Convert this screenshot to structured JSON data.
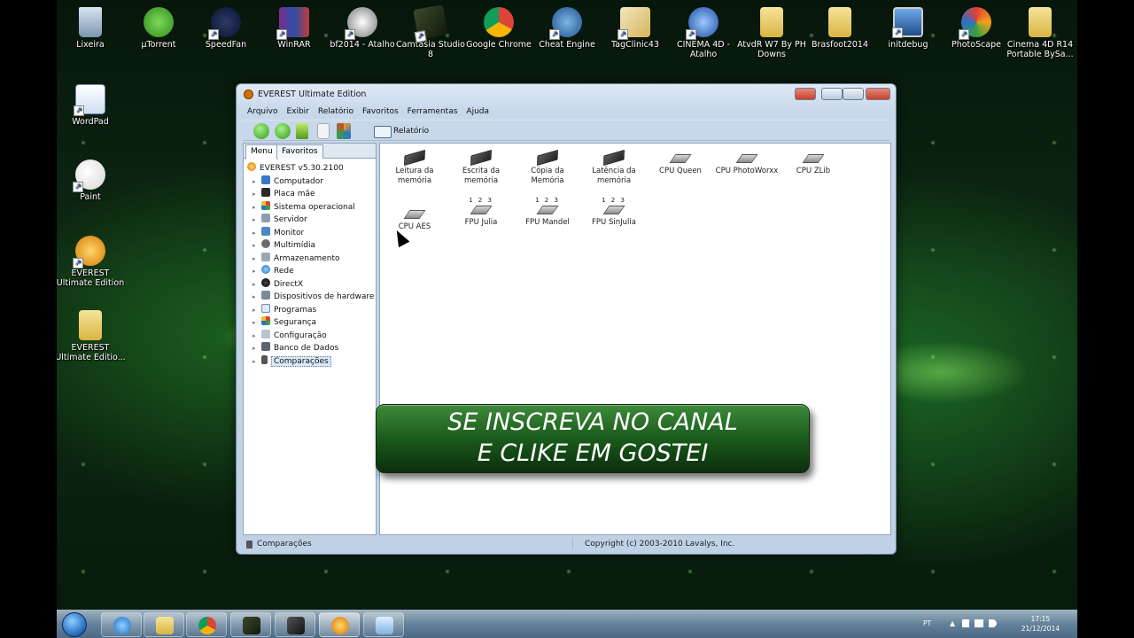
{
  "desktop": {
    "icons": [
      {
        "label": "Lixeira",
        "icon": "recycle-bin-icon"
      },
      {
        "label": "µTorrent",
        "icon": "utorrent-icon"
      },
      {
        "label": "SpeedFan",
        "icon": "speedfan-icon"
      },
      {
        "label": "WinRAR",
        "icon": "winrar-icon"
      },
      {
        "label": "bf2014 - Atalho",
        "icon": "game-icon"
      },
      {
        "label": "Camtasia Studio 8",
        "icon": "camtasia-icon"
      },
      {
        "label": "Google Chrome",
        "icon": "chrome-icon"
      },
      {
        "label": "Cheat Engine",
        "icon": "cheat-engine-icon"
      },
      {
        "label": "TagClinic43",
        "icon": "tagclinic-icon"
      },
      {
        "label": "CINEMA 4D - Atalho",
        "icon": "cinema4d-icon"
      },
      {
        "label": "AtvdR W7 By PH Downs",
        "icon": "folder-icon"
      },
      {
        "label": "Brasfoot2014",
        "icon": "folder-icon"
      },
      {
        "label": "initdebug",
        "icon": "monitor-icon"
      },
      {
        "label": "PhotoScape",
        "icon": "photoscape-icon"
      },
      {
        "label": "Cinema 4D R14 Portable BySa...",
        "icon": "folder-icon"
      },
      {
        "label": "WordPad",
        "icon": "wordpad-icon"
      },
      {
        "label": "Paint",
        "icon": "paint-icon"
      },
      {
        "label": "EVEREST Ultimate Edition",
        "icon": "everest-icon"
      },
      {
        "label": "EVEREST Ultimate Editio...",
        "icon": "folder-icon"
      }
    ]
  },
  "window": {
    "title": "EVEREST Ultimate Edition",
    "menu": [
      "Arquivo",
      "Exibir",
      "Relatório",
      "Favoritos",
      "Ferramentas",
      "Ajuda"
    ],
    "toolbar": {
      "report_label": "Relatório"
    },
    "tabs": [
      "Menu",
      "Favoritos"
    ],
    "tree_root": "EVEREST v5.30.2100",
    "tree_items": [
      "Computador",
      "Placa mãe",
      "Sistema operacional",
      "Servidor",
      "Monitor",
      "Multimídia",
      "Armazenamento",
      "Rede",
      "DirectX",
      "Dispositivos de hardware",
      "Programas",
      "Segurança",
      "Configuração",
      "Banco de Dados",
      "Comparações"
    ],
    "selected_item": "Comparações",
    "benchmarks_row1": [
      {
        "label": "Leitura da memória",
        "kind": "chip"
      },
      {
        "label": "Escrita da memória",
        "kind": "chip"
      },
      {
        "label": "Cópia da Memória",
        "kind": "chip"
      },
      {
        "label": "Latência da memória",
        "kind": "chip"
      },
      {
        "label": "CPU Queen",
        "kind": "cpu"
      },
      {
        "label": "CPU PhotoWorxx",
        "kind": "cpu"
      },
      {
        "label": "CPU ZLib",
        "kind": "cpu"
      }
    ],
    "benchmarks_row2": [
      {
        "label": "CPU AES",
        "kind": "cpu"
      },
      {
        "label": "FPU Julia",
        "kind": "fpu"
      },
      {
        "label": "FPU Mandel",
        "kind": "fpu"
      },
      {
        "label": "FPU SinJulia",
        "kind": "fpu"
      }
    ],
    "fpu_digits": "1 2 3",
    "status_left": "Comparações",
    "status_right": "Copyright (c) 2003-2010 Lavalys, Inc."
  },
  "banner": {
    "line1": "SE INSCREVA NO CANAL",
    "line2": "E CLIKE EM GOSTEI"
  },
  "taskbar": {
    "apps": [
      "internet-explorer-icon",
      "explorer-icon",
      "chrome-icon",
      "camtasia-icon",
      "recorder-icon",
      "everest-icon",
      "window-icon"
    ],
    "lang": "PT",
    "time": "17:15",
    "date": "21/12/2014"
  },
  "colors": {
    "accent_green": "#1a5b1c",
    "window_frame": "#bfd1e6",
    "close_red": "#c9412e"
  }
}
